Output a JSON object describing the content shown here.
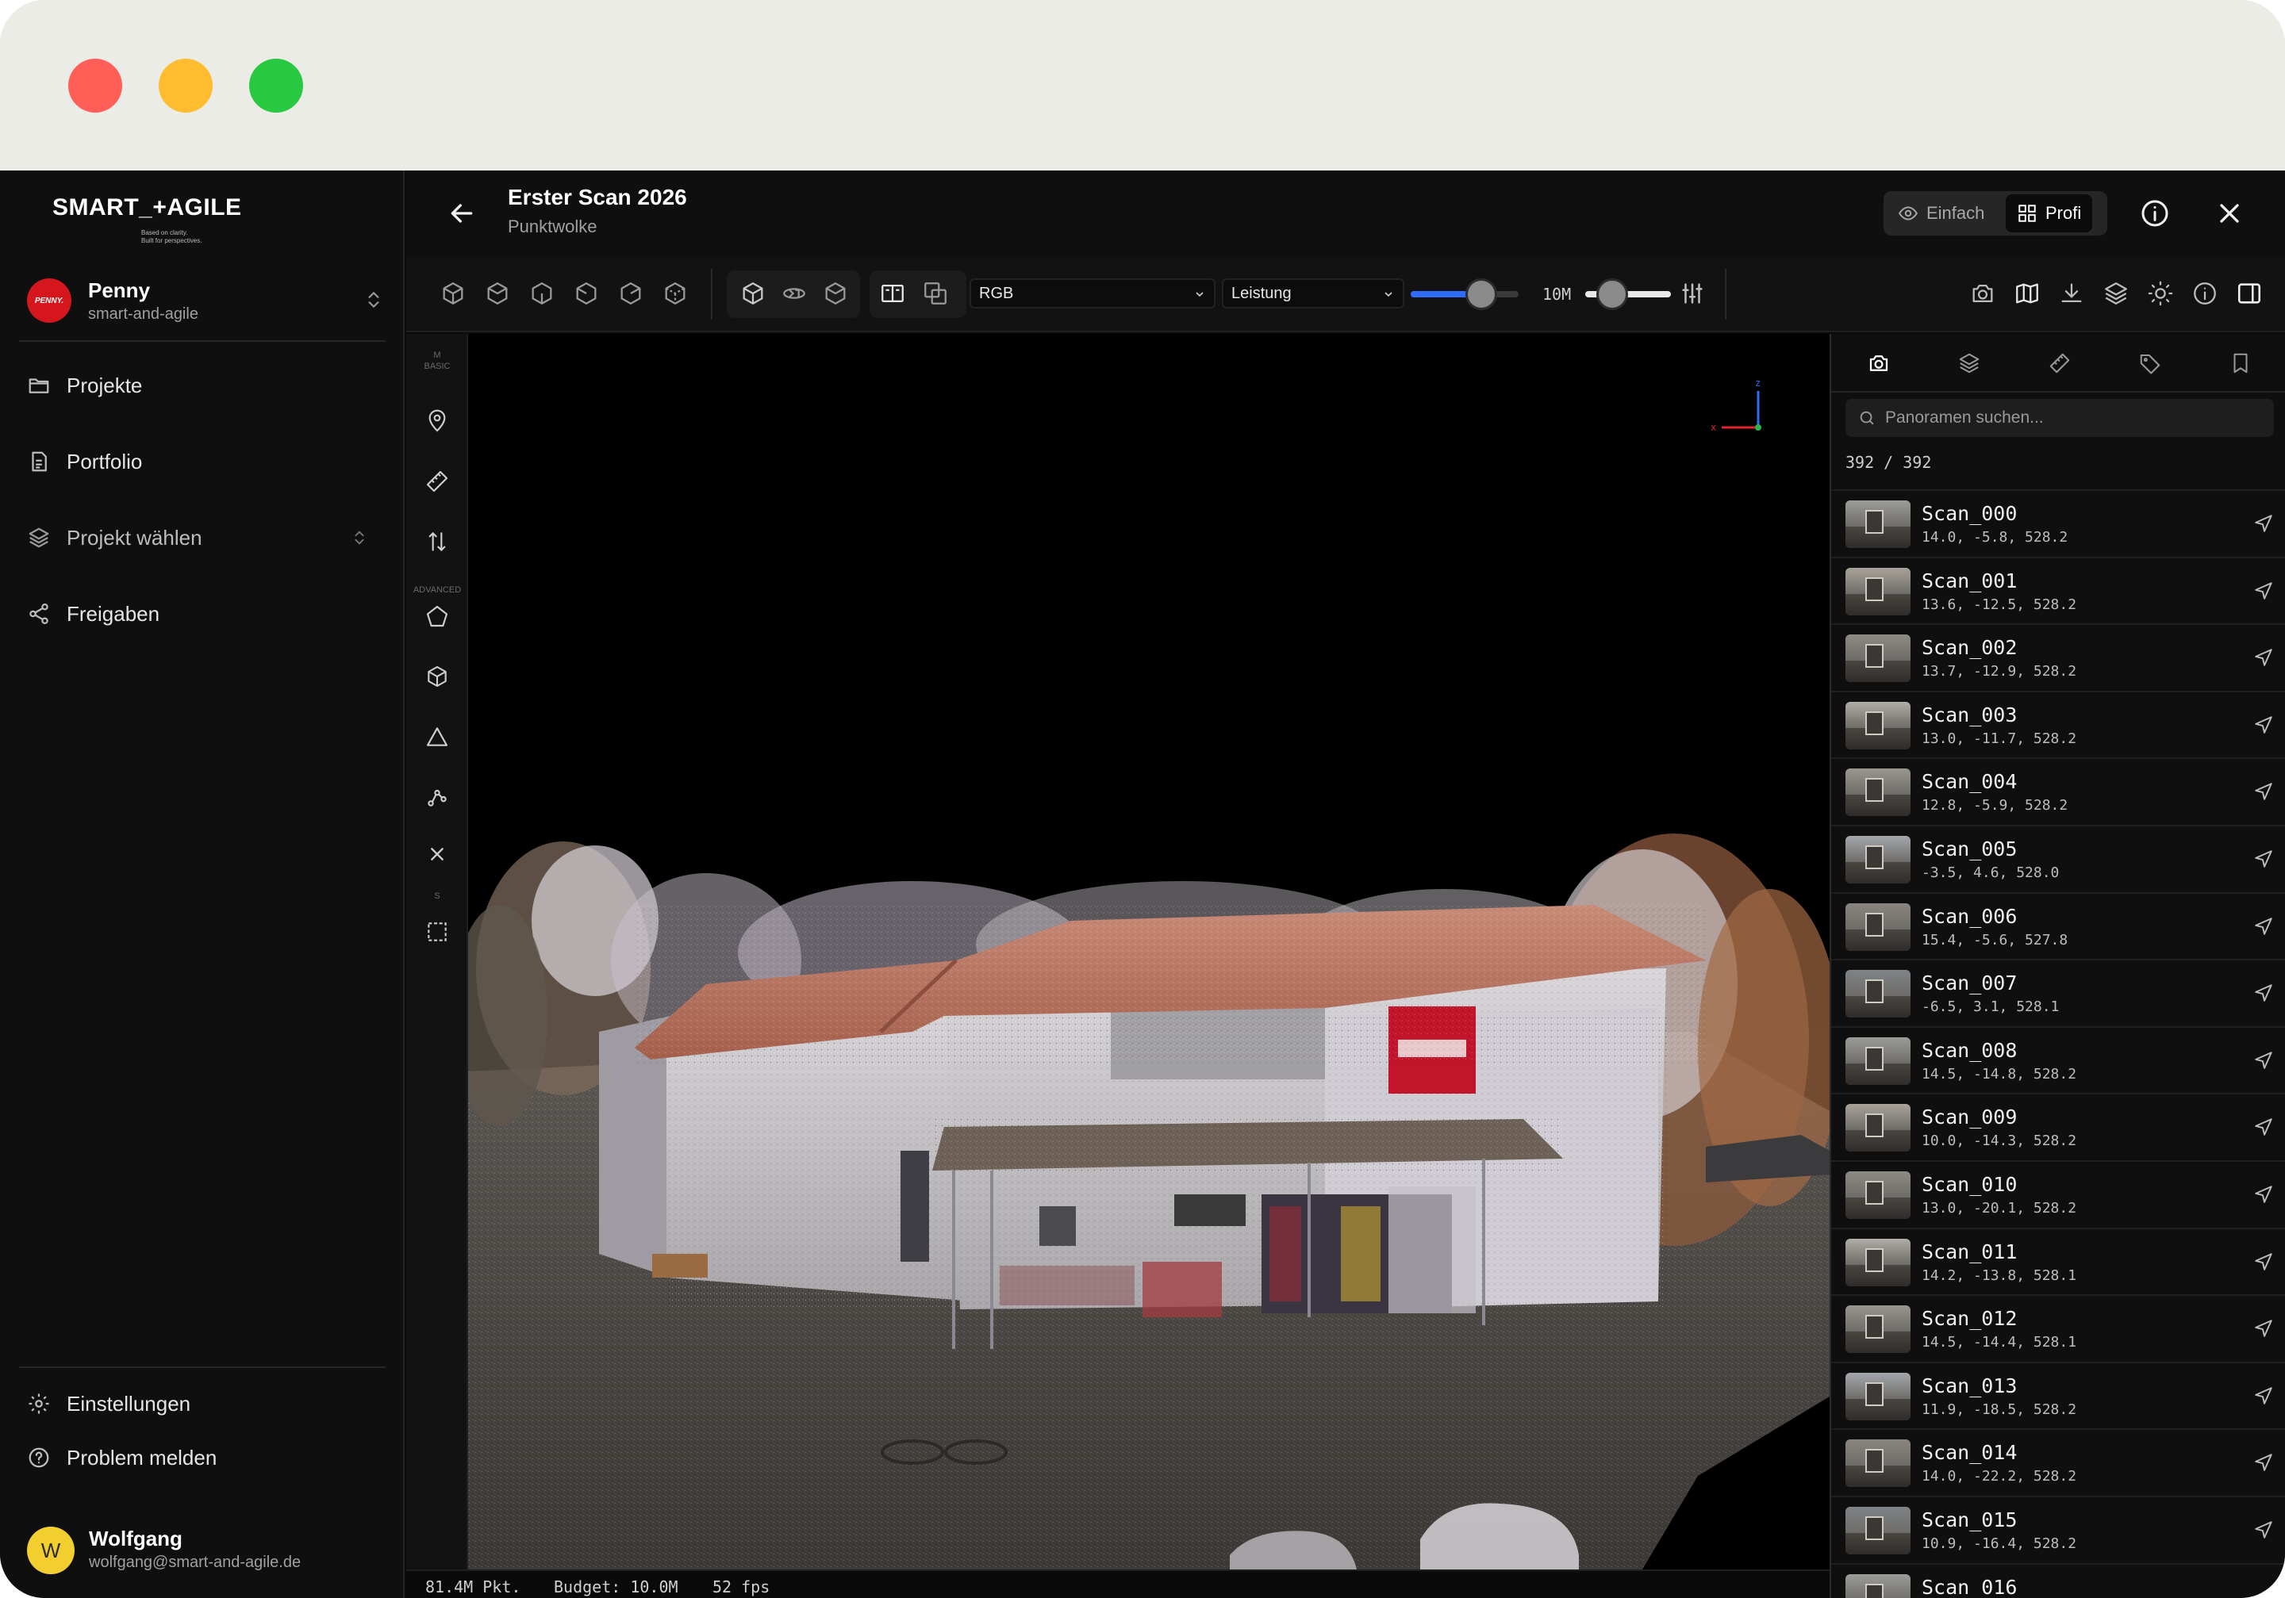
{
  "window": {
    "controls": {
      "close_color": "#FF5F57",
      "minimize_color": "#FEBC2E",
      "zoom_color": "#28C840"
    }
  },
  "brand": {
    "logo_text": "SMART_+AGILE",
    "tagline_1": "Based on clarity.",
    "tagline_2": "Built for perspectives."
  },
  "org": {
    "name": "Penny",
    "slug": "smart-and-agile",
    "avatar_text": "PENNY.",
    "avatar_color": "#D5161C"
  },
  "sidebar": {
    "items": [
      {
        "label": "Projekte",
        "icon": "folder-icon"
      },
      {
        "label": "Portfolio",
        "icon": "document-icon"
      },
      {
        "label": "Projekt wählen",
        "icon": "layers-icon"
      },
      {
        "label": "Freigaben",
        "icon": "share-icon"
      }
    ],
    "bottom": [
      {
        "label": "Einstellungen",
        "icon": "gear-icon"
      },
      {
        "label": "Problem melden",
        "icon": "help-icon"
      }
    ]
  },
  "user": {
    "name": "Wolfgang",
    "email": "wolfgang@smart-and-agile.de",
    "initial": "W"
  },
  "header": {
    "title": "Erster Scan 2026",
    "subtitle": "Punktwolke",
    "mode_simple": "Einfach",
    "mode_pro": "Profi",
    "active_mode": "Profi"
  },
  "toolbar": {
    "color_select": "RGB",
    "quality_select": "Leistung",
    "point_size_level": 0.72,
    "budget_label": "10M",
    "budget_level": 0.2,
    "accent_color": "#2F6BFF"
  },
  "rail": {
    "basic_label": "BASIC",
    "advanced_label": "ADVANCED",
    "section_m": "M",
    "section_s": "S"
  },
  "axes": {
    "z": "z",
    "x": "x"
  },
  "panel": {
    "search_placeholder": "Panoramen suchen...",
    "count": "392 / 392",
    "scans": [
      {
        "name": "Scan_000",
        "coords": "14.0, -5.8, 528.2"
      },
      {
        "name": "Scan_001",
        "coords": "13.6, -12.5, 528.2"
      },
      {
        "name": "Scan_002",
        "coords": "13.7, -12.9, 528.2"
      },
      {
        "name": "Scan_003",
        "coords": "13.0, -11.7, 528.2"
      },
      {
        "name": "Scan_004",
        "coords": "12.8, -5.9, 528.2"
      },
      {
        "name": "Scan_005",
        "coords": "-3.5, 4.6, 528.0"
      },
      {
        "name": "Scan_006",
        "coords": "15.4, -5.6, 527.8"
      },
      {
        "name": "Scan_007",
        "coords": "-6.5, 3.1, 528.1"
      },
      {
        "name": "Scan_008",
        "coords": "14.5, -14.8, 528.2"
      },
      {
        "name": "Scan_009",
        "coords": "10.0, -14.3, 528.2"
      },
      {
        "name": "Scan_010",
        "coords": "13.0, -20.1, 528.2"
      },
      {
        "name": "Scan_011",
        "coords": "14.2, -13.8, 528.1"
      },
      {
        "name": "Scan_012",
        "coords": "14.5, -14.4, 528.1"
      },
      {
        "name": "Scan_013",
        "coords": "11.9, -18.5, 528.2"
      },
      {
        "name": "Scan_014",
        "coords": "14.0, -22.2, 528.2"
      },
      {
        "name": "Scan_015",
        "coords": "10.9, -16.4, 528.2"
      },
      {
        "name": "Scan_016",
        "coords": ""
      }
    ]
  },
  "status": {
    "points": "81.4M Pkt.",
    "budget": "Budget: 10.0M",
    "fps": "52 fps"
  }
}
